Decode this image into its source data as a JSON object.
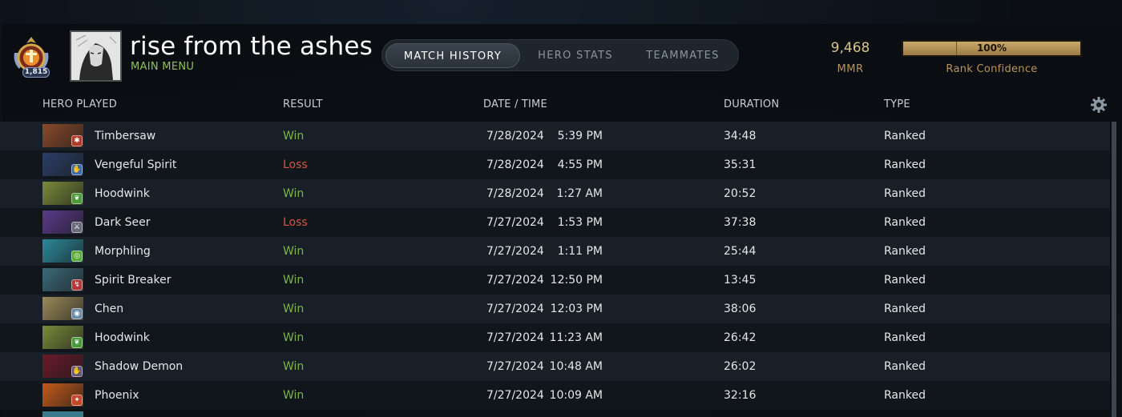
{
  "header": {
    "rank_number": "1,815",
    "player_name": "rise from the ashes",
    "main_menu_label": "MAIN MENU",
    "tabs": [
      {
        "label": "MATCH HISTORY",
        "active": true
      },
      {
        "label": "HERO STATS",
        "active": false
      },
      {
        "label": "TEAMMATES",
        "active": false
      }
    ],
    "mmr_value": "9,468",
    "mmr_label": "MMR",
    "rank_confidence_value": "100%",
    "rank_confidence_fraction": 1.0,
    "rank_confidence_label": "Rank Confidence"
  },
  "columns": {
    "hero": "HERO PLAYED",
    "result": "RESULT",
    "datetime": "DATE / TIME",
    "duration": "DURATION",
    "type": "TYPE"
  },
  "matches": [
    {
      "hero": "Timbersaw",
      "result": "Win",
      "date": "7/28/2024",
      "time": "5:39 PM",
      "duration": "34:48",
      "type": "Ranked",
      "portrait_color": "#8a4a2a",
      "badge_color": "#b23a2a",
      "badge_icon": "gear"
    },
    {
      "hero": "Vengeful Spirit",
      "result": "Loss",
      "date": "7/28/2024",
      "time": "4:55 PM",
      "duration": "35:31",
      "type": "Ranked",
      "portrait_color": "#2a3e66",
      "badge_color": "#3a6ab0",
      "badge_icon": "hand"
    },
    {
      "hero": "Hoodwink",
      "result": "Win",
      "date": "7/28/2024",
      "time": "1:27 AM",
      "duration": "20:52",
      "type": "Ranked",
      "portrait_color": "#7a8a3a",
      "badge_color": "#4a9a3a",
      "badge_icon": "leaf"
    },
    {
      "hero": "Dark Seer",
      "result": "Loss",
      "date": "7/27/2024",
      "time": "1:53 PM",
      "duration": "37:38",
      "type": "Ranked",
      "portrait_color": "#5a3a8a",
      "badge_color": "#6a6a7a",
      "badge_icon": "sword"
    },
    {
      "hero": "Morphling",
      "result": "Win",
      "date": "7/27/2024",
      "time": "1:11 PM",
      "duration": "25:44",
      "type": "Ranked",
      "portrait_color": "#2a8a9a",
      "badge_color": "#5aaa3a",
      "badge_icon": "swirl"
    },
    {
      "hero": "Spirit Breaker",
      "result": "Win",
      "date": "7/27/2024",
      "time": "12:50 PM",
      "duration": "13:45",
      "type": "Ranked",
      "portrait_color": "#3a6a7a",
      "badge_color": "#b23a3a",
      "badge_icon": "bolt"
    },
    {
      "hero": "Chen",
      "result": "Win",
      "date": "7/27/2024",
      "time": "12:03 PM",
      "duration": "38:06",
      "type": "Ranked",
      "portrait_color": "#9a8a5a",
      "badge_color": "#6a8aaa",
      "badge_icon": "circle"
    },
    {
      "hero": "Hoodwink",
      "result": "Win",
      "date": "7/27/2024",
      "time": "11:23 AM",
      "duration": "26:42",
      "type": "Ranked",
      "portrait_color": "#7a8a3a",
      "badge_color": "#4a9a3a",
      "badge_icon": "leaf"
    },
    {
      "hero": "Shadow Demon",
      "result": "Win",
      "date": "7/27/2024",
      "time": "10:48 AM",
      "duration": "26:02",
      "type": "Ranked",
      "portrait_color": "#6a1a2a",
      "badge_color": "#5a5a7a",
      "badge_icon": "hand"
    },
    {
      "hero": "Phoenix",
      "result": "Win",
      "date": "7/27/2024",
      "time": "10:09 AM",
      "duration": "32:16",
      "type": "Ranked",
      "portrait_color": "#c25a1a",
      "badge_color": "#c24a2a",
      "badge_icon": "flame"
    }
  ]
}
